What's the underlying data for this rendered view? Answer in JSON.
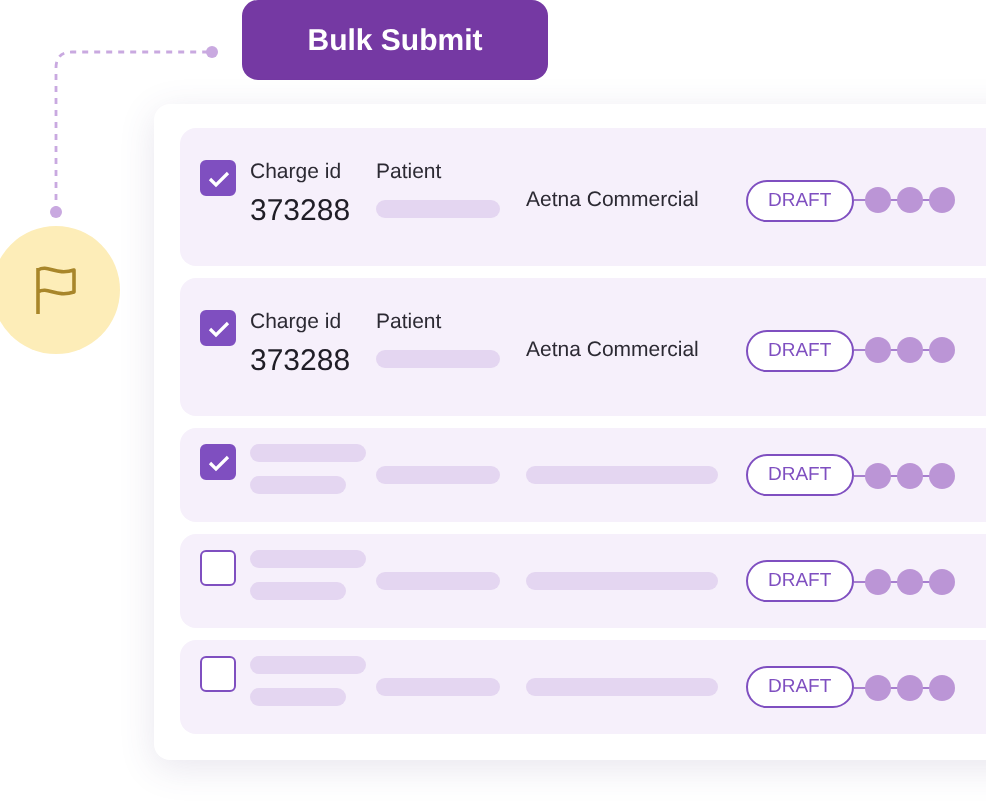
{
  "action_button": {
    "label": "Bulk Submit"
  },
  "rows": [
    {
      "kind": "detail",
      "checked": true,
      "charge_label": "Charge id",
      "charge_id": "373288",
      "patient_label": "Patient",
      "payer": "Aetna Commercial",
      "status": "DRAFT"
    },
    {
      "kind": "detail",
      "checked": true,
      "charge_label": "Charge id",
      "charge_id": "373288",
      "patient_label": "Patient",
      "payer": "Aetna Commercial",
      "status": "DRAFT"
    },
    {
      "kind": "placeholder",
      "checked": true,
      "status": "DRAFT"
    },
    {
      "kind": "placeholder",
      "checked": false,
      "status": "DRAFT"
    },
    {
      "kind": "placeholder",
      "checked": false,
      "status": "DRAFT"
    }
  ]
}
